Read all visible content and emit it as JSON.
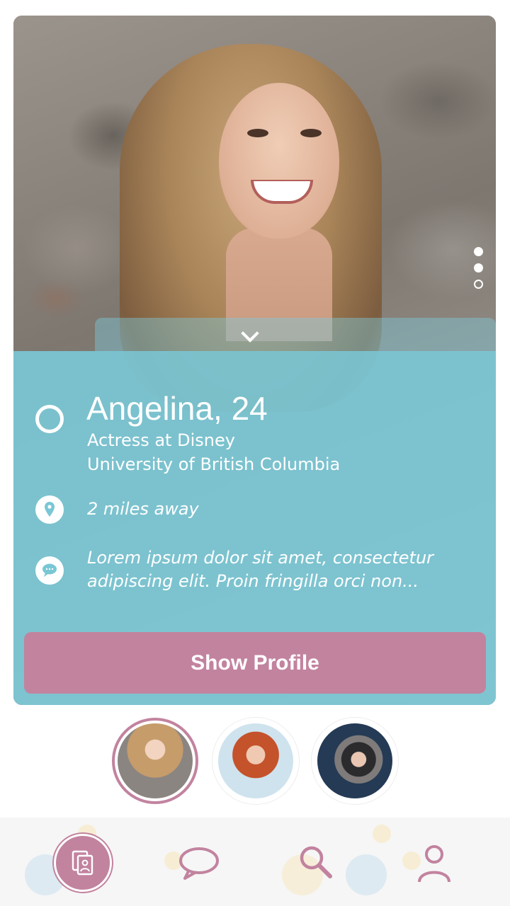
{
  "profile": {
    "name": "Angelina, 24",
    "job": "Actress at Disney",
    "school": "University of British Columbia",
    "distance": "2 miles away",
    "bio_line1": "Lorem ipsum dolor sit amet, consectetur",
    "bio_line2": "adipiscing elit. Proin fringilla orci non...",
    "photo_index": 1,
    "photo_count": 3
  },
  "actions": {
    "show_profile_label": "Show Profile"
  },
  "icons": {
    "status": "circle-ring-icon",
    "location": "map-pin-icon",
    "bio": "speech-bubble-icon",
    "expand": "chevron-down-icon"
  },
  "nav": {
    "items": [
      "cards-icon",
      "chat-icon",
      "search-icon",
      "profile-icon"
    ],
    "active": 0
  },
  "colors": {
    "accent": "#c2839f",
    "overlay": "#79c7d5",
    "nav_bg": "#f6f6f6"
  }
}
